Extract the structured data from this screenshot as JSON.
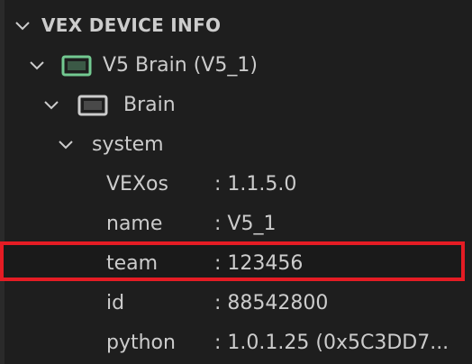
{
  "section": {
    "title": "VEX DEVICE INFO"
  },
  "device": {
    "label": "V5 Brain (V5_1)",
    "icon": "v5-brain-icon"
  },
  "brain": {
    "label": "Brain",
    "icon": "brain-icon"
  },
  "system": {
    "label": "system",
    "items": [
      {
        "key": "VEXos",
        "value": ": 1.1.5.0"
      },
      {
        "key": "name",
        "value": ": V5_1"
      },
      {
        "key": "team",
        "value": ": 123456"
      },
      {
        "key": "id",
        "value": ": 88542800"
      },
      {
        "key": "python",
        "value": ": 1.0.1.25 (0x5C3DD7..."
      }
    ]
  },
  "colors": {
    "background": "#1e1e1e",
    "text": "#cccccc",
    "highlight_border": "#e51c24",
    "device_icon_green": "#73c991"
  }
}
